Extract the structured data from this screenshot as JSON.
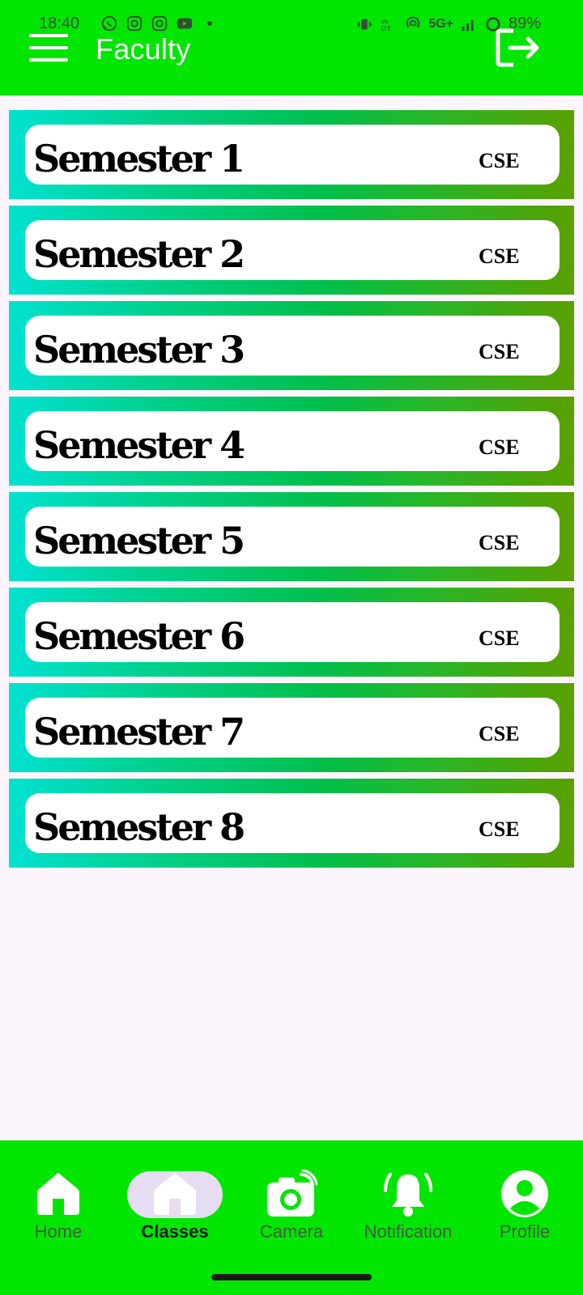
{
  "status_bar": {
    "time": "18:40",
    "battery": "89%",
    "network": "5G+"
  },
  "app_bar": {
    "title": "Faculty"
  },
  "semesters": [
    {
      "title": "Semester 1",
      "dept": "CSE"
    },
    {
      "title": "Semester 2",
      "dept": "CSE"
    },
    {
      "title": "Semester 3",
      "dept": "CSE"
    },
    {
      "title": "Semester 4",
      "dept": "CSE"
    },
    {
      "title": "Semester 5",
      "dept": "CSE"
    },
    {
      "title": "Semester 6",
      "dept": "CSE"
    },
    {
      "title": "Semester 7",
      "dept": "CSE"
    },
    {
      "title": "Semester 8",
      "dept": "CSE"
    }
  ],
  "bottom_nav": [
    {
      "label": "Home",
      "icon": "home-icon"
    },
    {
      "label": "Classes",
      "icon": "classes-icon",
      "active": true
    },
    {
      "label": "Camera",
      "icon": "camera-icon"
    },
    {
      "label": "Notification",
      "icon": "notification-icon"
    },
    {
      "label": "Profile",
      "icon": "profile-icon"
    }
  ],
  "colors": {
    "primary_green": "#00e600",
    "gradient_start": "#00e2d2",
    "gradient_end": "#5aa000",
    "active_pill": "#e6ddf3",
    "page_background": "#fcf6fc"
  }
}
